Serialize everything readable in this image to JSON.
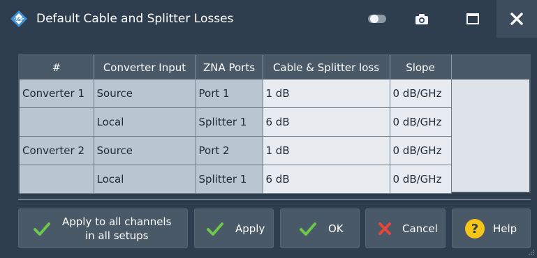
{
  "window": {
    "title": "Default Cable and Splitter Losses"
  },
  "table": {
    "headers": [
      "#",
      "Converter Input",
      "ZNA Ports",
      "Cable & Splitter loss",
      "Slope"
    ],
    "rows": [
      {
        "num": "Converter 1",
        "input": "Source",
        "port": "Port 1",
        "loss": "1 dB",
        "slope": "0 dB/GHz"
      },
      {
        "num": "",
        "input": "Local",
        "port": "Splitter 1",
        "loss": "6 dB",
        "slope": "0 dB/GHz"
      },
      {
        "num": "Converter 2",
        "input": "Source",
        "port": "Port 2",
        "loss": "1 dB",
        "slope": "0 dB/GHz"
      },
      {
        "num": "",
        "input": "Local",
        "port": "Splitter 1",
        "loss": "6 dB",
        "slope": "0 dB/GHz"
      }
    ]
  },
  "buttons": {
    "apply_all_line1": "Apply to all channels",
    "apply_all_line2": "in all setups",
    "apply": "Apply",
    "ok": "OK",
    "cancel": "Cancel",
    "help": "Help"
  },
  "icons": {
    "logo": "rohde-schwarz-logo",
    "toggle": "toggle-icon",
    "camera": "camera-icon",
    "maximize": "maximize-icon",
    "close": "close-icon",
    "check": "check-icon",
    "cancel": "cross-icon",
    "help": "help-icon"
  },
  "colors": {
    "check": "#6cc94a",
    "cancel": "#e8453c",
    "help": "#f5c518",
    "header": "#4a5968"
  }
}
